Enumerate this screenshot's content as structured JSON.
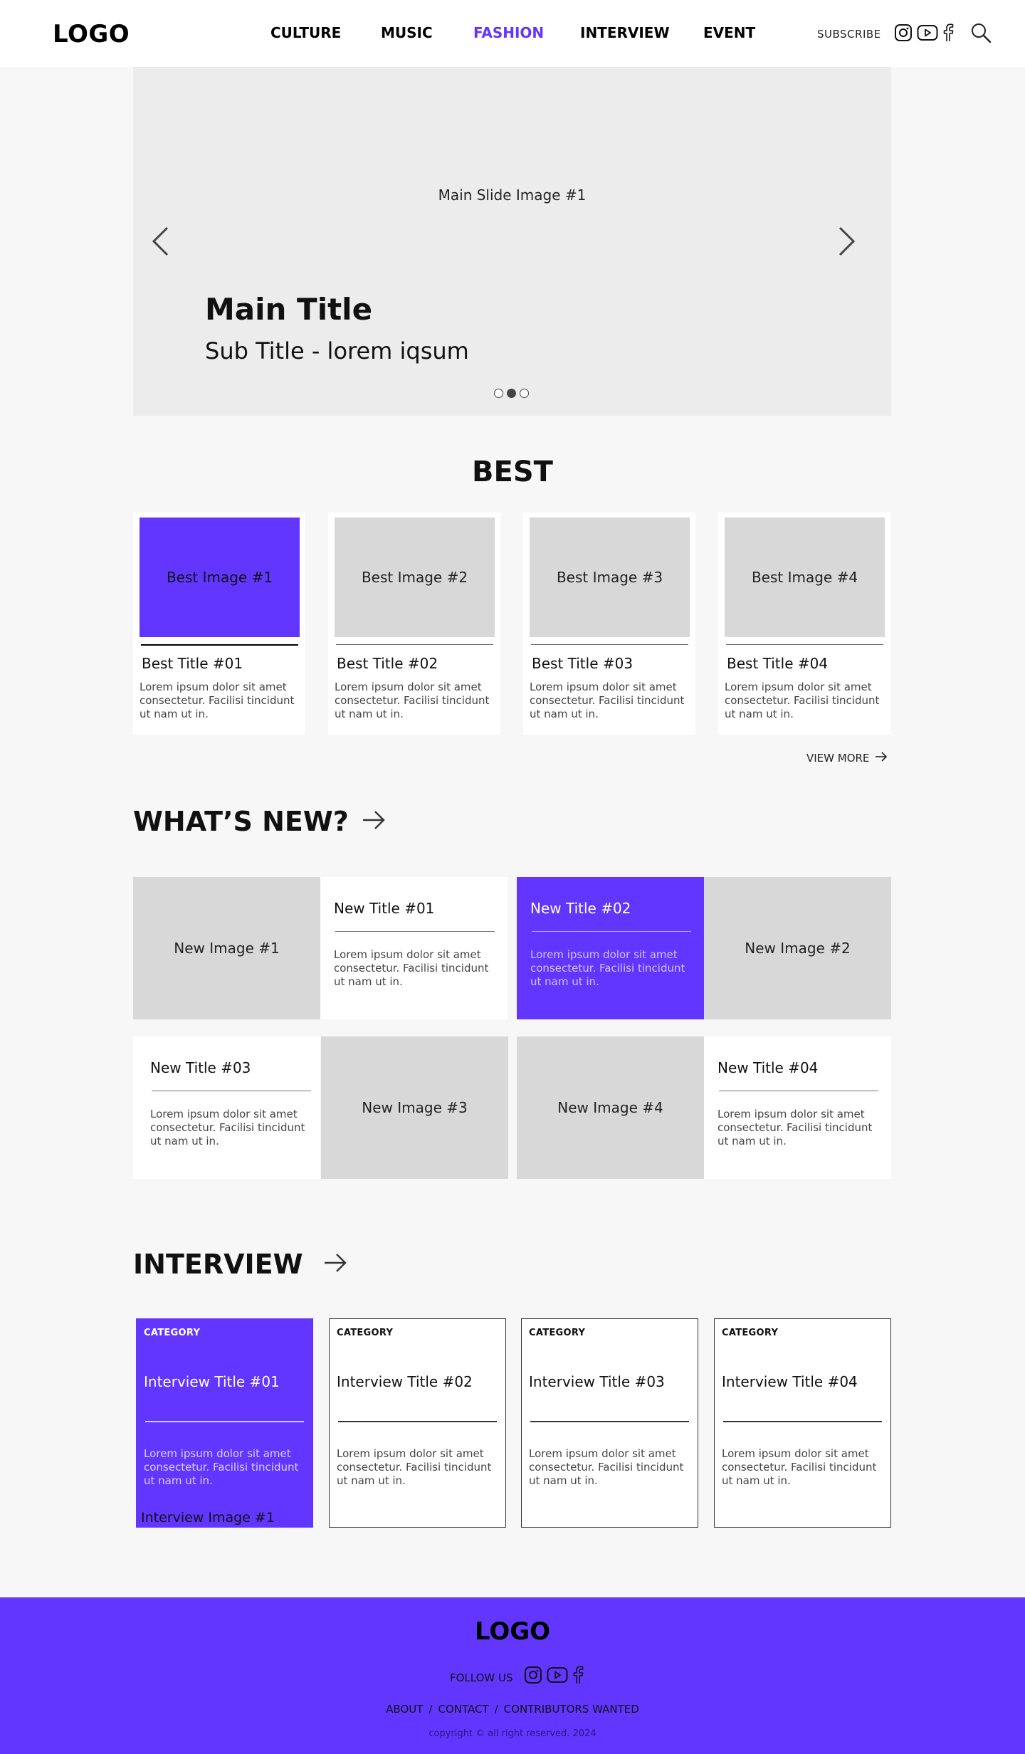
{
  "header": {
    "logo": "LOGO",
    "nav": [
      "CULTURE",
      "MUSIC",
      "FASHION",
      "INTERVIEW",
      "EVENT"
    ],
    "active_nav": "FASHION",
    "subscribe": "SUBSCRIBE",
    "icons": [
      "instagram-icon",
      "youtube-icon",
      "facebook-icon",
      "search-icon"
    ]
  },
  "hero": {
    "image_label": "Main Slide Image #1",
    "title": "Main Title",
    "subtitle": "Sub Title - lorem iqsum",
    "slide_count": 3,
    "active_slide": 2
  },
  "best": {
    "heading": "BEST",
    "items": [
      {
        "image": "Best Image #1",
        "title": "Best Title #01",
        "desc": "Lorem ipsum dolor sit amet consectetur. Facilisi tincidunt ut nam ut in."
      },
      {
        "image": "Best Image #2",
        "title": "Best Title #02",
        "desc": "Lorem ipsum dolor sit amet consectetur. Facilisi tincidunt ut nam ut in."
      },
      {
        "image": "Best Image #3",
        "title": "Best Title #03",
        "desc": "Lorem ipsum dolor sit amet consectetur. Facilisi tincidunt ut nam ut in."
      },
      {
        "image": "Best Image #4",
        "title": "Best Title #04",
        "desc": "Lorem ipsum dolor sit amet consectetur. Facilisi tincidunt ut nam ut in."
      }
    ],
    "view_more": "VIEW MORE"
  },
  "whats_new": {
    "heading": "WHAT’S NEW?",
    "images": [
      "New Image #1",
      "New Image #2",
      "New Image #3",
      "New Image #4"
    ],
    "items": [
      {
        "title": "New Title #01",
        "desc": "Lorem ipsum dolor sit amet consectetur. Facilisi tincidunt ut nam ut in."
      },
      {
        "title": "New Title #02",
        "desc": "Lorem ipsum dolor sit amet consectetur. Facilisi tincidunt ut nam ut in."
      },
      {
        "title": "New Title #03",
        "desc": "Lorem ipsum dolor sit amet consectetur. Facilisi tincidunt ut nam ut in."
      },
      {
        "title": "New Title #04",
        "desc": "Lorem ipsum dolor sit amet consectetur. Facilisi tincidunt ut nam ut in."
      }
    ]
  },
  "interview": {
    "heading": "INTERVIEW",
    "items": [
      {
        "category": "CATEGORY",
        "title": "Interview Title #01",
        "desc": "Lorem ipsum dolor sit amet consectetur. Facilisi tincidunt ut nam ut in.",
        "image": "Interview Image #1"
      },
      {
        "category": "CATEGORY",
        "title": "Interview Title #02",
        "desc": "Lorem ipsum dolor sit amet consectetur. Facilisi tincidunt ut nam ut in."
      },
      {
        "category": "CATEGORY",
        "title": "Interview Title #03",
        "desc": "Lorem ipsum dolor sit amet consectetur. Facilisi tincidunt ut nam ut in."
      },
      {
        "category": "CATEGORY",
        "title": "Interview Title #04",
        "desc": "Lorem ipsum dolor sit amet consectetur. Facilisi tincidunt ut nam ut in."
      }
    ]
  },
  "footer": {
    "logo": "LOGO",
    "follow_us": "FOLLOW US",
    "links": [
      "ABOUT",
      "CONTACT",
      "CONTRIBUTORS WANTED"
    ],
    "copyright": "copyright © all right reserved. 2024"
  },
  "colors": {
    "accent": "#6236ff",
    "placeholder": "#d8d8d8",
    "hero_bg": "#ececec",
    "page_bg": "#f7f7f7"
  }
}
